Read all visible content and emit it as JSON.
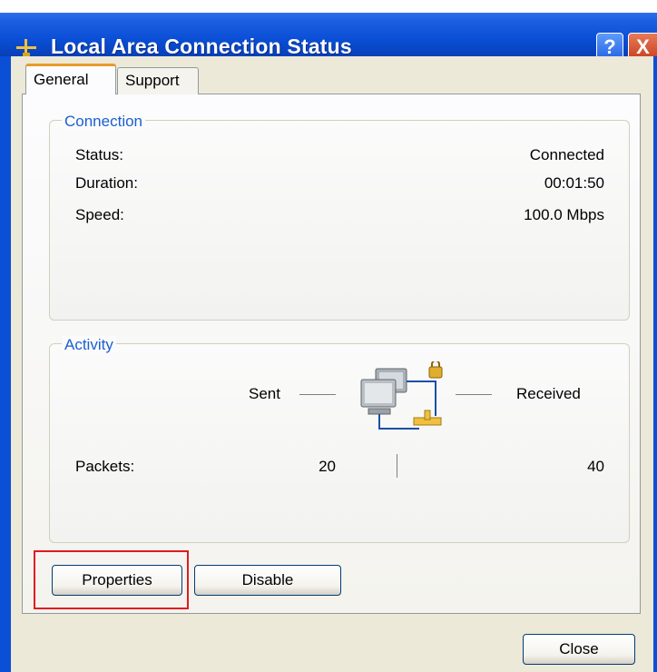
{
  "window": {
    "title": "Local Area Connection Status",
    "help_button": "?",
    "close_button": "X"
  },
  "tabs": [
    {
      "label": "General",
      "active": true
    },
    {
      "label": "Support",
      "active": false
    }
  ],
  "connection": {
    "legend": "Connection",
    "rows": [
      {
        "label": "Status:",
        "value": "Connected"
      },
      {
        "label": "Duration:",
        "value": "00:01:50"
      },
      {
        "label": "Speed:",
        "value": "100.0 Mbps"
      }
    ]
  },
  "activity": {
    "legend": "Activity",
    "sent_label": "Sent",
    "received_label": "Received",
    "packets_label": "Packets:",
    "packets_sent": "20",
    "packets_received": "40",
    "icon": "network-computers-icon"
  },
  "buttons": {
    "properties": "Properties",
    "disable": "Disable",
    "close": "Close"
  },
  "colors": {
    "titlebar": "#0a4fd6",
    "legend_text": "#1c5fd1",
    "highlight": "#e11b22",
    "active_tab_accent": "#e79b2a"
  }
}
